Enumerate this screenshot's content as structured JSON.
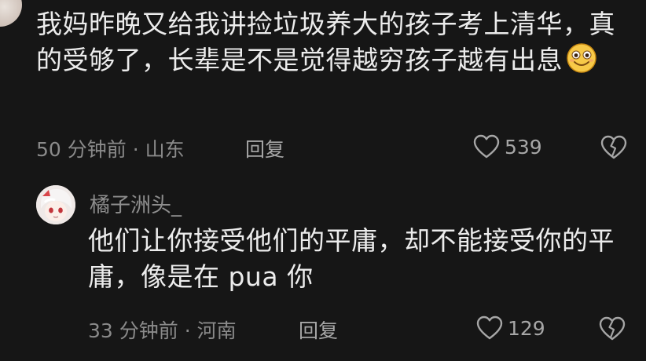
{
  "comments": [
    {
      "text": "我妈昨晚又给我讲捡垃圾养大的孩子考上清华，真的受够了，长辈是不是觉得越穷孩子越有出息",
      "emoji": "smiling-face-emoji",
      "time_location": "50 分钟前 · 山东",
      "reply_label": "回复",
      "likes": "539"
    },
    {
      "username": "橘子洲头_",
      "text": "他们让你接受他们的平庸，却不能接受你的平庸，像是在 pua 你",
      "time_location": "33 分钟前 · 河南",
      "reply_label": "回复",
      "likes": "129"
    }
  ],
  "colors": {
    "background": "#161616",
    "text": "#ececec",
    "meta": "#8a8a8a"
  },
  "icons": [
    "heart-outline-icon",
    "broken-heart-icon"
  ]
}
